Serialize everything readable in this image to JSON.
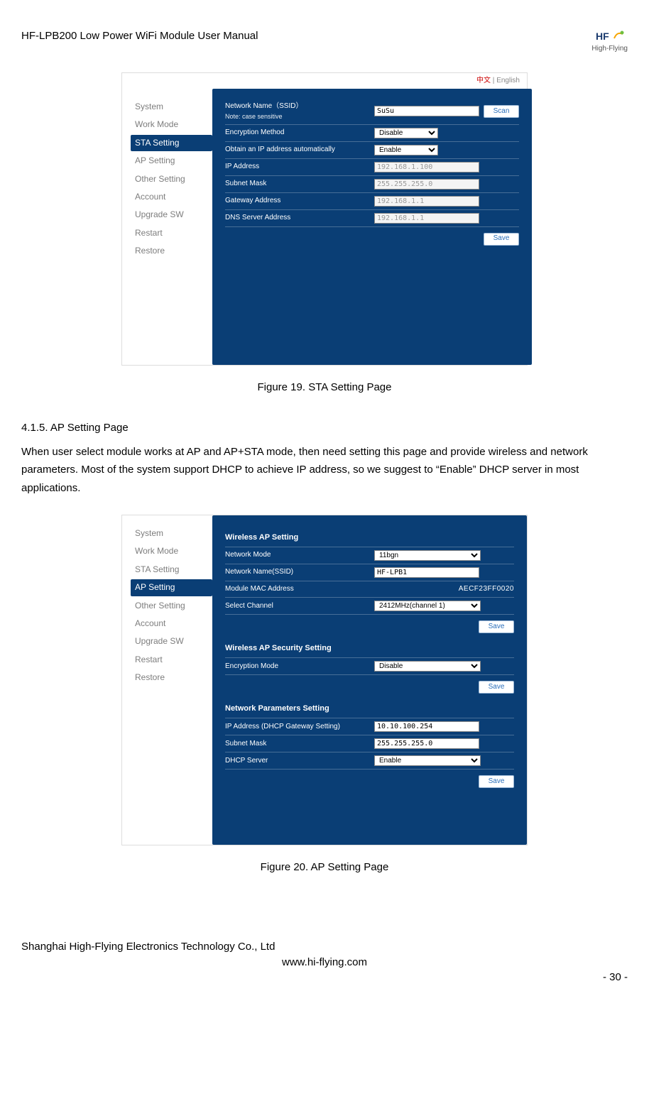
{
  "doc": {
    "header_title": "HF-LPB200 Low Power WiFi Module User Manual",
    "logo_text": "High-Flying"
  },
  "lang": {
    "cn": "中文",
    "sep": " | ",
    "en": "English"
  },
  "sidebar": {
    "items": [
      {
        "label": "System"
      },
      {
        "label": "Work Mode"
      },
      {
        "label": "STA Setting"
      },
      {
        "label": "AP Setting"
      },
      {
        "label": "Other Setting"
      },
      {
        "label": "Account"
      },
      {
        "label": "Upgrade SW"
      },
      {
        "label": "Restart"
      },
      {
        "label": "Restore"
      }
    ],
    "active_panel1": 2,
    "active_panel2": 3
  },
  "sta": {
    "ssid_label": "Network Name（SSID）",
    "ssid_note": "Note: case sensitive",
    "ssid_value": "SuSu",
    "scan": "Scan",
    "enc_label": "Encryption Method",
    "enc_value": "Disable",
    "auto_ip_label": "Obtain an IP address automatically",
    "auto_ip_value": "Enable",
    "ip_label": "IP Address",
    "ip_value": "192.168.1.100",
    "mask_label": "Subnet Mask",
    "mask_value": "255.255.255.0",
    "gw_label": "Gateway Address",
    "gw_value": "192.168.1.1",
    "dns_label": "DNS Server Address",
    "dns_value": "192.168.1.1",
    "save": "Save"
  },
  "caption1": "Figure 19.    STA Setting Page",
  "section415": {
    "heading": "4.1.5.    AP Setting Page",
    "body": "When user select module works at AP and AP+STA mode, then need setting this page and provide wireless and network parameters. Most of the system support DHCP to achieve IP address, so we suggest to “Enable” DHCP server in most applications."
  },
  "ap": {
    "head1": "Wireless AP Setting",
    "mode_label": "Network Mode",
    "mode_value": "11bgn",
    "ssid_label": "Network Name(SSID)",
    "ssid_value": "HF-LPB1",
    "mac_label": "Module MAC Address",
    "mac_value": "AECF23FF0020",
    "ch_label": "Select Channel",
    "ch_value": "2412MHz(channel 1)",
    "head2": "Wireless AP Security Setting",
    "enc_label": "Encryption Mode",
    "enc_value": "Disable",
    "head3": "Network Parameters Setting",
    "ip_label": "IP Address (DHCP Gateway Setting)",
    "ip_value": "10.10.100.254",
    "mask_label": "Subnet Mask",
    "mask_value": "255.255.255.0",
    "dhcp_label": "DHCP Server",
    "dhcp_value": "Enable",
    "save": "Save"
  },
  "caption2": "Figure 20.    AP Setting Page",
  "footer": {
    "company": "Shanghai High-Flying Electronics Technology Co., Ltd",
    "site": "www.hi-flying.com",
    "page": "- 30 -"
  }
}
